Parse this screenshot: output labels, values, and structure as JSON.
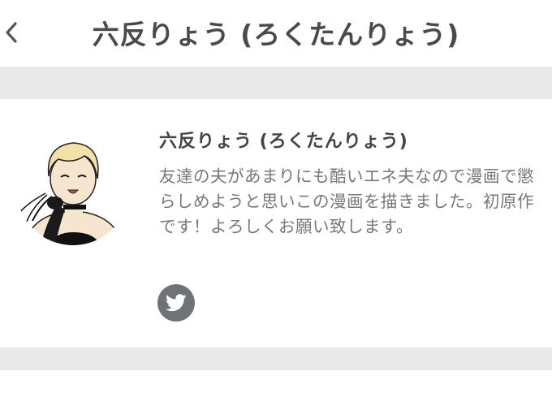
{
  "header": {
    "title": "六反りょう (ろくたんりょう)",
    "back_icon": "chevron-left-icon"
  },
  "profile": {
    "name": "六反りょう (ろくたんりょう)",
    "bio": "友達の夫があまりにも酷いエネ夫なので漫画で懲らしめようと思いこの漫画を描きました。初原作です！よろしくお願い致します。",
    "social_icon": "twitter-icon"
  },
  "colors": {
    "background": "#ffffff",
    "band": "#e9e9ea",
    "title_text": "#4a4a4a",
    "bio_text": "#777777",
    "twitter_circle": "#707376"
  }
}
